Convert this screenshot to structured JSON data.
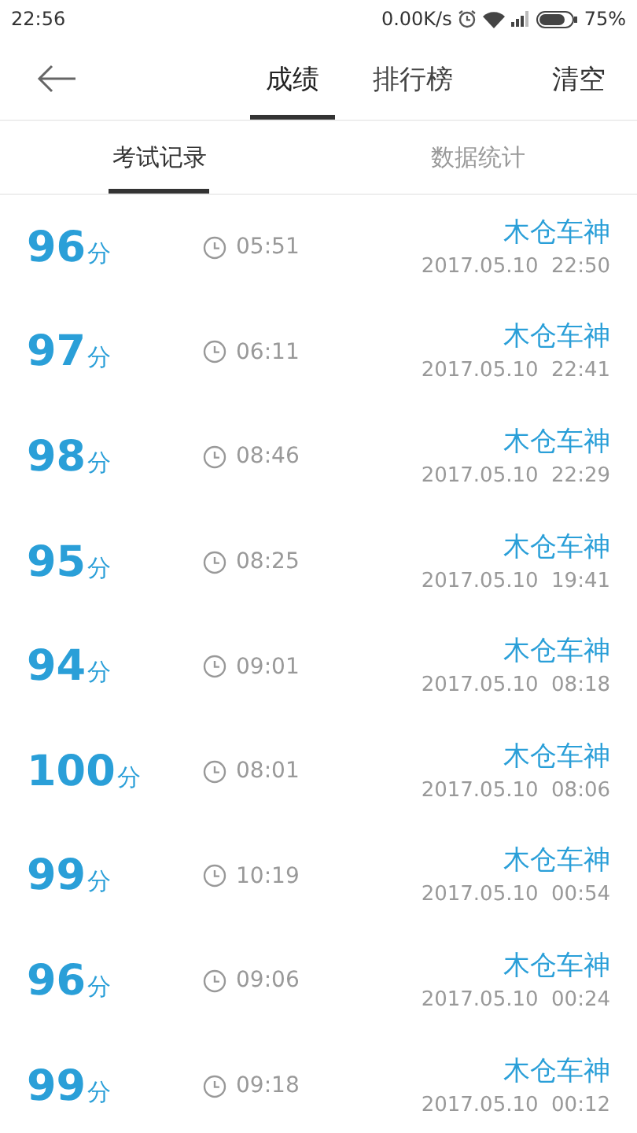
{
  "status_bar": {
    "time": "22:56",
    "speed": "0.00K/s",
    "battery": "75%"
  },
  "nav": {
    "tabs": [
      {
        "label": "成绩",
        "selected": true
      },
      {
        "label": "排行榜",
        "selected": false
      }
    ],
    "action": "清空"
  },
  "sub_tabs": [
    {
      "label": "考试记录",
      "selected": true
    },
    {
      "label": "数据统计",
      "selected": false
    }
  ],
  "records": [
    {
      "score": "96",
      "unit": "分",
      "duration": "05:51",
      "name": "木仓车神",
      "date": "2017.05.10  22:50"
    },
    {
      "score": "97",
      "unit": "分",
      "duration": "06:11",
      "name": "木仓车神",
      "date": "2017.05.10  22:41"
    },
    {
      "score": "98",
      "unit": "分",
      "duration": "08:46",
      "name": "木仓车神",
      "date": "2017.05.10  22:29"
    },
    {
      "score": "95",
      "unit": "分",
      "duration": "08:25",
      "name": "木仓车神",
      "date": "2017.05.10  19:41"
    },
    {
      "score": "94",
      "unit": "分",
      "duration": "09:01",
      "name": "木仓车神",
      "date": "2017.05.10  08:18"
    },
    {
      "score": "100",
      "unit": "分",
      "duration": "08:01",
      "name": "木仓车神",
      "date": "2017.05.10  08:06"
    },
    {
      "score": "99",
      "unit": "分",
      "duration": "10:19",
      "name": "木仓车神",
      "date": "2017.05.10  00:54"
    },
    {
      "score": "96",
      "unit": "分",
      "duration": "09:06",
      "name": "木仓车神",
      "date": "2017.05.10  00:24"
    },
    {
      "score": "99",
      "unit": "分",
      "duration": "09:18",
      "name": "木仓车神",
      "date": "2017.05.10  00:12"
    }
  ]
}
